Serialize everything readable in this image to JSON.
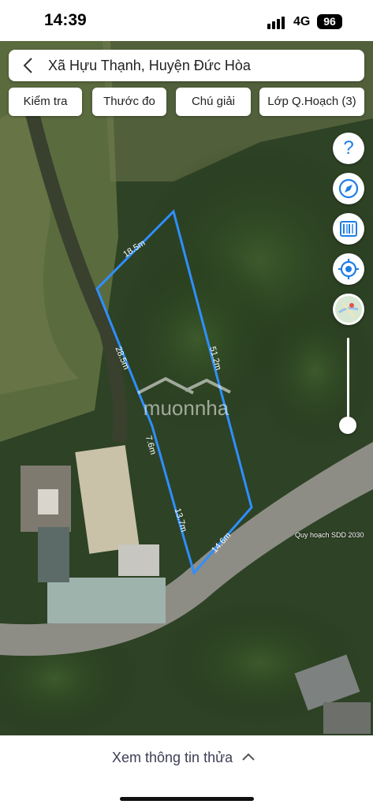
{
  "status_bar": {
    "time": "14:39",
    "network": "4G",
    "battery": "96"
  },
  "search": {
    "text": "Xã Hựu Thạnh, Huyện Đức Hòa",
    "back_icon": "chevron-left-icon"
  },
  "toolbar": {
    "buttons": [
      {
        "label": "Kiểm tra"
      },
      {
        "label": "Thước đo"
      },
      {
        "label": "Chú giải"
      },
      {
        "label": "Lớp Q.Hoạch (3)"
      }
    ]
  },
  "map_controls": {
    "icons": [
      "help-icon",
      "compass-icon",
      "barcode-icon",
      "locate-icon",
      "map-layer-icon"
    ],
    "help_glyph": "?"
  },
  "parcel": {
    "outline_color": "#2f8fff",
    "edges": [
      {
        "label": "18.5m"
      },
      {
        "label": "51.2m"
      },
      {
        "label": "14.6m"
      },
      {
        "label": "13.7m"
      },
      {
        "label": "7.6m"
      },
      {
        "label": "28.5m"
      }
    ]
  },
  "watermark": {
    "text": "muonnha"
  },
  "layer_caption": "Quy hoạch SDD 2030",
  "bottom": {
    "info_text": "Xem thông tin thửa"
  }
}
